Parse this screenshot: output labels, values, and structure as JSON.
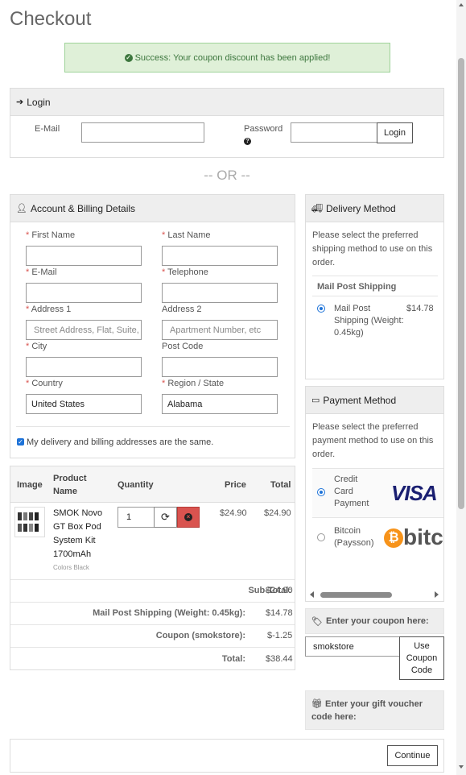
{
  "page": {
    "title": "Checkout"
  },
  "alert": {
    "text": "Success: Your coupon discount has been applied!"
  },
  "login": {
    "heading": "Login",
    "email_label": "E-Mail",
    "password_label": "Password",
    "button": "Login"
  },
  "or_text": "-- OR --",
  "account": {
    "heading": "Account & Billing Details",
    "first_name": "First Name",
    "last_name": "Last Name",
    "email": "E-Mail",
    "telephone": "Telephone",
    "address1": "Address 1",
    "address1_placeholder": "Street Address, Flat, Suite,",
    "address2": "Address 2",
    "address2_placeholder": "Apartment Number, etc",
    "city": "City",
    "postcode": "Post Code",
    "country": "Country",
    "country_value": "United States",
    "region": "Region / State",
    "region_value": "Alabama",
    "same_address": "My delivery and billing addresses are the same."
  },
  "delivery": {
    "heading": "Delivery Method",
    "description": "Please select the preferred shipping method to use on this order.",
    "group": "Mail Post Shipping",
    "option_label": "Mail Post Shipping (Weight: 0.45kg)",
    "option_price": "$14.78"
  },
  "payment": {
    "heading": "Payment Method",
    "description": "Please select the preferred payment method to use on this order.",
    "options": [
      {
        "label": "Credit Card Payment",
        "logo": "VISA"
      },
      {
        "label": "Bitcoin (Paysson)",
        "logo": "bitc"
      }
    ]
  },
  "cart": {
    "headers": {
      "image": "Image",
      "product": "Product Name",
      "quantity": "Quantity",
      "price": "Price",
      "total": "Total"
    },
    "item": {
      "name": "SMOK Novo GT Box Pod System Kit 1700mAh",
      "option": "Colors Black",
      "quantity": "1",
      "price": "$24.90",
      "total": "$24.90"
    },
    "totals": [
      {
        "label": "Sub-Total:",
        "value": "$24.90"
      },
      {
        "label": "Mail Post Shipping (Weight: 0.45kg):",
        "value": "$14.78"
      },
      {
        "label": "Coupon (smokstore):",
        "value": "$-1.25"
      },
      {
        "label": "Total:",
        "value": "$38.44"
      }
    ]
  },
  "coupon": {
    "heading": "Enter your coupon here:",
    "value": "smokstore",
    "button": "Use Coupon Code"
  },
  "voucher": {
    "heading": "Enter your gift voucher code here:"
  },
  "continue_button": "Continue",
  "colors": {
    "alert_bg": "#dff0d8",
    "danger": "#d9534f",
    "visa_blue": "#1a1f71",
    "bitcoin_orange": "#f7931a"
  }
}
